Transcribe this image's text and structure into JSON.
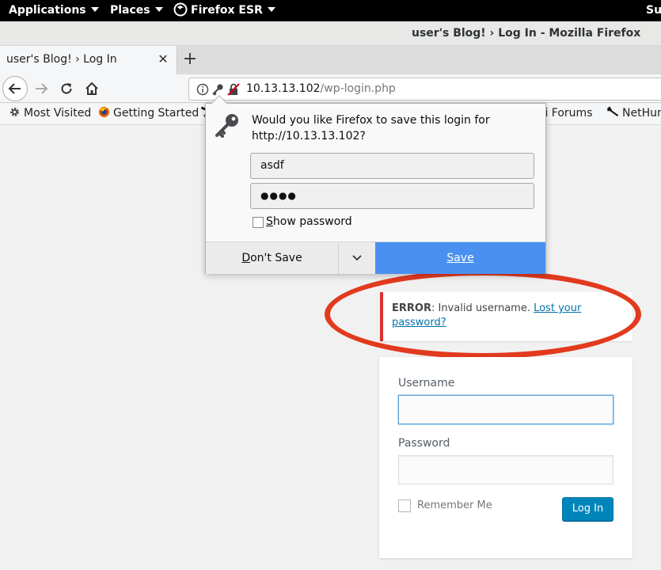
{
  "topbar": {
    "applications": "Applications",
    "places": "Places",
    "firefox": "Firefox ESR",
    "clock_partial": "Su"
  },
  "window": {
    "title": "user's Blog! › Log In - Mozilla Firefox"
  },
  "tabs": [
    {
      "title": "user's Blog! › Log In",
      "active": true
    }
  ],
  "navbar": {
    "url_host": "10.13.13.102",
    "url_path": "/wp-login.php"
  },
  "bookmarks": {
    "most_visited": "Most Visited",
    "getting_started": "Getting Started",
    "kali_forums": "ali Forums",
    "nethunter": "NetHun"
  },
  "doorhanger": {
    "message": "Would you like Firefox to save this login for http://10.13.13.102?",
    "username": "asdf",
    "password_mask": "●●●●",
    "show_password_first": "S",
    "show_password_rest": "how password",
    "dont_save_first": "D",
    "dont_save_rest": "on't Save",
    "save_label": "Save"
  },
  "wp_error": {
    "label": "ERROR",
    "message": ": Invalid username. ",
    "link": "Lost your password?"
  },
  "login_form": {
    "username_label": "Username",
    "username_value": "",
    "password_label": "Password",
    "remember_label": "Remember Me",
    "submit_label": "Log In"
  },
  "colors": {
    "error_border": "#dc3232",
    "annotation": "#e23a1e",
    "save_button": "#4a90f0",
    "wp_button": "#0085ba",
    "link": "#0073aa"
  }
}
